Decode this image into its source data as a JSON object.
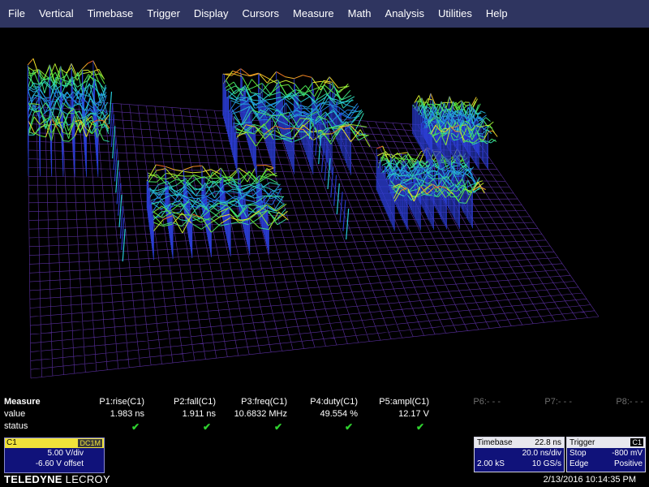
{
  "menu": [
    "File",
    "Vertical",
    "Timebase",
    "Trigger",
    "Display",
    "Cursors",
    "Measure",
    "Math",
    "Analysis",
    "Utilities",
    "Help"
  ],
  "measure": {
    "title": "Measure",
    "row_labels": {
      "value": "value",
      "status": "status"
    },
    "params": [
      {
        "name": "P1:rise(C1)",
        "value": "1.983 ns",
        "status": "✔"
      },
      {
        "name": "P2:fall(C1)",
        "value": "1.911 ns",
        "status": "✔"
      },
      {
        "name": "P3:freq(C1)",
        "value": "10.6832 MHz",
        "status": "✔"
      },
      {
        "name": "P4:duty(C1)",
        "value": "49.554 %",
        "status": "✔"
      },
      {
        "name": "P5:ampl(C1)",
        "value": "12.17 V",
        "status": "✔"
      },
      {
        "name": "P6:- - -",
        "value": "",
        "status": ""
      },
      {
        "name": "P7:- - -",
        "value": "",
        "status": ""
      },
      {
        "name": "P8:- - -",
        "value": "",
        "status": ""
      }
    ]
  },
  "channel": {
    "name": "C1",
    "coupling": "DC1M",
    "vdiv": "5.00 V/div",
    "offset": "-6.60 V offset",
    "color": "#f0e23a"
  },
  "timebase": {
    "label": "Timebase",
    "delay": "22.8 ns",
    "per_div": "20.0 ns/div",
    "samples": "2.00 kS",
    "rate": "10 GS/s"
  },
  "trigger": {
    "label": "Trigger",
    "source": "C1",
    "mode": "Stop",
    "level": "-800 mV",
    "type": "Edge",
    "slope": "Positive"
  },
  "brand": {
    "name_bold": "TELEDYNE",
    "name_rest": " LECROY"
  },
  "timestamp": "2/13/2016 10:14:35 PM",
  "colors": {
    "menubar": "#2f3560",
    "grid": "#5a2fa0",
    "status_ok": "#2fd12f"
  }
}
